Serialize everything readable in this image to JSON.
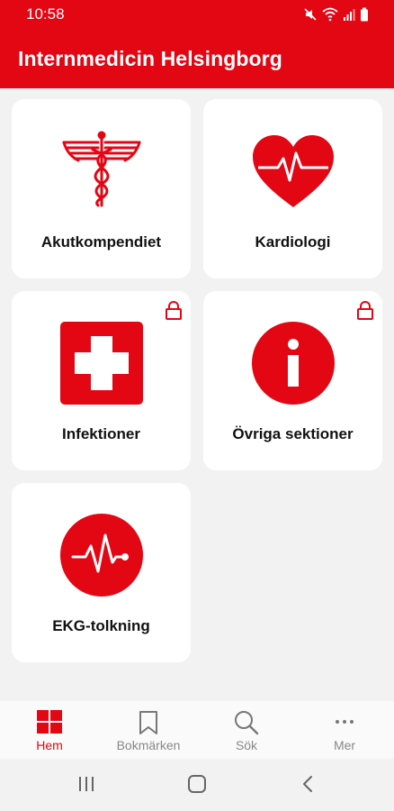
{
  "status": {
    "time": "10:58"
  },
  "app": {
    "title": "Internmedicin Helsingborg"
  },
  "cards": [
    {
      "label": "Akutkompendiet",
      "icon": "caduceus-icon",
      "locked": false
    },
    {
      "label": "Kardiologi",
      "icon": "heart-pulse-icon",
      "locked": false
    },
    {
      "label": "Infektioner",
      "icon": "medical-cross-icon",
      "locked": true
    },
    {
      "label": "Övriga sektioner",
      "icon": "info-icon",
      "locked": true
    },
    {
      "label": "EKG-tolkning",
      "icon": "ecg-icon",
      "locked": false
    }
  ],
  "nav": [
    {
      "label": "Hem",
      "icon": "grid-icon",
      "active": true
    },
    {
      "label": "Bokmärken",
      "icon": "bookmark-icon",
      "active": false
    },
    {
      "label": "Sök",
      "icon": "search-icon",
      "active": false
    },
    {
      "label": "Mer",
      "icon": "more-icon",
      "active": false
    }
  ],
  "colors": {
    "accent": "#e30613",
    "background": "#f2f2f2",
    "card": "#ffffff",
    "nav_inactive": "#888888"
  }
}
